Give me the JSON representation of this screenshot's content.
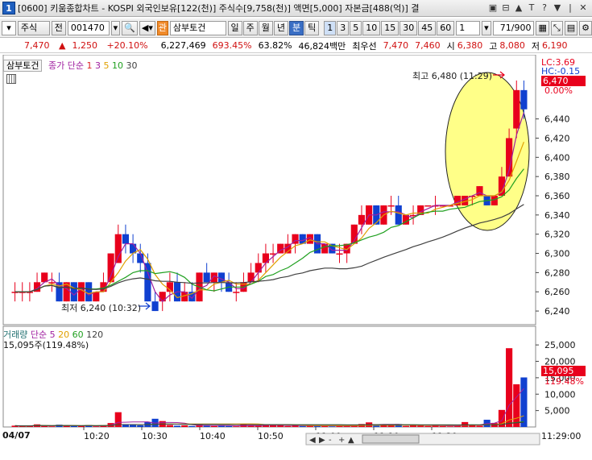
{
  "window": {
    "number": "1",
    "title": "[0600] 키움종합차트 - KOSPI 외국인보유[122(천)] 주식수[9,758(천)] 액면[5,000] 자본금[488(억)] 결",
    "buttons": [
      "▣",
      "⊟",
      "▲",
      "T",
      "?",
      "▼",
      "|",
      "✕"
    ]
  },
  "toolbar": {
    "market": "주식",
    "prev": "전",
    "code": "001470",
    "stock_badge": "관",
    "stock_name": "삼부토건",
    "periods": [
      "일",
      "주",
      "월",
      "년",
      "분",
      "틱"
    ],
    "selected_period": "분",
    "intervals": [
      "1",
      "3",
      "5",
      "10",
      "15",
      "30",
      "45",
      "60"
    ],
    "selected_interval": "1",
    "unit": "1",
    "count": "71",
    "count_total": "/900"
  },
  "quote": {
    "price": "7,470",
    "change": "1,250",
    "rate": "+20.10%",
    "volume": "6,227,469",
    "turnover": "693.45%",
    "ratio": "63.82%",
    "amount": "46,824백만",
    "pref_label": "최우선",
    "ask": "7,470",
    "bid": "7,460",
    "open_label": "시",
    "open": "6,380",
    "high_label": "고",
    "high": "8,080",
    "low_label": "저",
    "low": "6,190"
  },
  "price_panel": {
    "name": "삼부토건",
    "ma_label": "종가 단순",
    "ma_periods": [
      "1",
      "3",
      "5",
      "10",
      "30"
    ],
    "ma_colors": [
      "#d22",
      "#a020a0",
      "#e0a000",
      "#20a020",
      "#404040"
    ],
    "lc_label": "LC:3.69",
    "hc_label": "HC:-0.15",
    "current_price_box": "6,470",
    "pct_label": "0.00%",
    "high_annotation": "최고 6,480 (11:29)",
    "low_annotation": "최저 6,240 (10:32)",
    "y_ticks": [
      "6,440",
      "6,420",
      "6,400",
      "6,380",
      "6,360",
      "6,340",
      "6,320",
      "6,300",
      "6,280",
      "6,260",
      "6,240"
    ]
  },
  "volume_panel": {
    "title": "거래량",
    "ma_label": "단순",
    "ma_periods": [
      "5",
      "20",
      "60",
      "120"
    ],
    "ma_colors": [
      "#a020a0",
      "#e0a000",
      "#20a020",
      "#404040"
    ],
    "current": "15,095주(119.48%)",
    "current_box": "15,095",
    "pct_box": "119.48%",
    "y_ticks": [
      "25,000",
      "20,000",
      "15,000",
      "10,000",
      "5,000"
    ]
  },
  "x_axis": {
    "date": "04/07",
    "ticks": [
      "10:20",
      "10:30",
      "10:40",
      "10:50",
      "11:00",
      "11:10",
      "11:20"
    ],
    "end_label": "11:29:00",
    "controls": [
      "◀",
      "▶",
      "-",
      "+",
      "▲"
    ]
  },
  "colors": {
    "up": "#e8001c",
    "down": "#1040d0",
    "highlight": "#ffff88"
  },
  "chart_data": {
    "type": "candlestick",
    "x_range": [
      "10:09",
      "11:29"
    ],
    "ylim": [
      6230,
      6490
    ],
    "candles": [
      {
        "o": 6260,
        "h": 6270,
        "l": 6250,
        "c": 6260
      },
      {
        "o": 6260,
        "h": 6270,
        "l": 6250,
        "c": 6260
      },
      {
        "o": 6260,
        "h": 6270,
        "l": 6250,
        "c": 6260
      },
      {
        "o": 6260,
        "h": 6280,
        "l": 6260,
        "c": 6270
      },
      {
        "o": 6270,
        "h": 6280,
        "l": 6270,
        "c": 6280
      },
      {
        "o": 6270,
        "h": 6280,
        "l": 6260,
        "c": 6270
      },
      {
        "o": 6270,
        "h": 6280,
        "l": 6250,
        "c": 6250
      },
      {
        "o": 6250,
        "h": 6270,
        "l": 6250,
        "c": 6270
      },
      {
        "o": 6270,
        "h": 6270,
        "l": 6250,
        "c": 6250
      },
      {
        "o": 6250,
        "h": 6270,
        "l": 6250,
        "c": 6270
      },
      {
        "o": 6270,
        "h": 6270,
        "l": 6250,
        "c": 6250
      },
      {
        "o": 6250,
        "h": 6260,
        "l": 6250,
        "c": 6260
      },
      {
        "o": 6260,
        "h": 6280,
        "l": 6260,
        "c": 6270
      },
      {
        "o": 6270,
        "h": 6300,
        "l": 6270,
        "c": 6300
      },
      {
        "o": 6290,
        "h": 6330,
        "l": 6290,
        "c": 6320
      },
      {
        "o": 6320,
        "h": 6330,
        "l": 6300,
        "c": 6310
      },
      {
        "o": 6310,
        "h": 6320,
        "l": 6290,
        "c": 6300
      },
      {
        "o": 6300,
        "h": 6310,
        "l": 6280,
        "c": 6290
      },
      {
        "o": 6290,
        "h": 6300,
        "l": 6250,
        "c": 6250
      },
      {
        "o": 6250,
        "h": 6260,
        "l": 6240,
        "c": 6240
      },
      {
        "o": 6250,
        "h": 6260,
        "l": 6240,
        "c": 6260
      },
      {
        "o": 6260,
        "h": 6280,
        "l": 6250,
        "c": 6270
      },
      {
        "o": 6270,
        "h": 6280,
        "l": 6250,
        "c": 6250
      },
      {
        "o": 6250,
        "h": 6270,
        "l": 6250,
        "c": 6260
      },
      {
        "o": 6260,
        "h": 6270,
        "l": 6250,
        "c": 6250
      },
      {
        "o": 6250,
        "h": 6280,
        "l": 6250,
        "c": 6280
      },
      {
        "o": 6280,
        "h": 6290,
        "l": 6270,
        "c": 6270
      },
      {
        "o": 6270,
        "h": 6280,
        "l": 6260,
        "c": 6280
      },
      {
        "o": 6280,
        "h": 6280,
        "l": 6260,
        "c": 6270
      },
      {
        "o": 6270,
        "h": 6280,
        "l": 6260,
        "c": 6260
      },
      {
        "o": 6260,
        "h": 6270,
        "l": 6250,
        "c": 6260
      },
      {
        "o": 6260,
        "h": 6280,
        "l": 6260,
        "c": 6270
      },
      {
        "o": 6270,
        "h": 6290,
        "l": 6270,
        "c": 6280
      },
      {
        "o": 6280,
        "h": 6300,
        "l": 6270,
        "c": 6290
      },
      {
        "o": 6290,
        "h": 6310,
        "l": 6280,
        "c": 6300
      },
      {
        "o": 6300,
        "h": 6310,
        "l": 6290,
        "c": 6300
      },
      {
        "o": 6300,
        "h": 6310,
        "l": 6300,
        "c": 6310
      },
      {
        "o": 6300,
        "h": 6320,
        "l": 6300,
        "c": 6310
      },
      {
        "o": 6310,
        "h": 6320,
        "l": 6300,
        "c": 6320
      },
      {
        "o": 6320,
        "h": 6320,
        "l": 6310,
        "c": 6310
      },
      {
        "o": 6310,
        "h": 6320,
        "l": 6310,
        "c": 6320
      },
      {
        "o": 6320,
        "h": 6320,
        "l": 6300,
        "c": 6300
      },
      {
        "o": 6300,
        "h": 6310,
        "l": 6300,
        "c": 6310
      },
      {
        "o": 6310,
        "h": 6310,
        "l": 6300,
        "c": 6300
      },
      {
        "o": 6300,
        "h": 6310,
        "l": 6290,
        "c": 6300
      },
      {
        "o": 6300,
        "h": 6310,
        "l": 6290,
        "c": 6310
      },
      {
        "o": 6310,
        "h": 6330,
        "l": 6310,
        "c": 6330
      },
      {
        "o": 6330,
        "h": 6350,
        "l": 6320,
        "c": 6340
      },
      {
        "o": 6330,
        "h": 6350,
        "l": 6330,
        "c": 6350
      },
      {
        "o": 6350,
        "h": 6350,
        "l": 6330,
        "c": 6330
      },
      {
        "o": 6330,
        "h": 6350,
        "l": 6330,
        "c": 6350
      },
      {
        "o": 6350,
        "h": 6360,
        "l": 6340,
        "c": 6350
      },
      {
        "o": 6350,
        "h": 6360,
        "l": 6330,
        "c": 6330
      },
      {
        "o": 6330,
        "h": 6340,
        "l": 6330,
        "c": 6340
      },
      {
        "o": 6340,
        "h": 6350,
        "l": 6330,
        "c": 6340
      },
      {
        "o": 6340,
        "h": 6350,
        "l": 6340,
        "c": 6350
      },
      {
        "o": 6350,
        "h": 6350,
        "l": 6350,
        "c": 6350
      },
      {
        "o": 6350,
        "h": 6360,
        "l": 6340,
        "c": 6350
      },
      {
        "o": 6350,
        "h": 6350,
        "l": 6350,
        "c": 6350
      },
      {
        "o": 6350,
        "h": 6350,
        "l": 6350,
        "c": 6350
      },
      {
        "o": 6350,
        "h": 6360,
        "l": 6350,
        "c": 6360
      },
      {
        "o": 6350,
        "h": 6360,
        "l": 6350,
        "c": 6360
      },
      {
        "o": 6360,
        "h": 6360,
        "l": 6350,
        "c": 6360
      },
      {
        "o": 6360,
        "h": 6370,
        "l": 6360,
        "c": 6370
      },
      {
        "o": 6360,
        "h": 6360,
        "l": 6350,
        "c": 6350
      },
      {
        "o": 6350,
        "h": 6360,
        "l": 6350,
        "c": 6360
      },
      {
        "o": 6360,
        "h": 6390,
        "l": 6360,
        "c": 6380
      },
      {
        "o": 6380,
        "h": 6430,
        "l": 6380,
        "c": 6420
      },
      {
        "o": 6430,
        "h": 6480,
        "l": 6420,
        "c": 6470
      },
      {
        "o": 6470,
        "h": 6480,
        "l": 6440,
        "c": 6450
      }
    ],
    "volume": [
      400,
      300,
      350,
      800,
      300,
      200,
      700,
      400,
      250,
      300,
      600,
      200,
      500,
      1200,
      4500,
      800,
      600,
      500,
      1500,
      2500,
      1800,
      600,
      400,
      500,
      300,
      700,
      400,
      300,
      500,
      300,
      200,
      800,
      500,
      400,
      700,
      600,
      500,
      300,
      400,
      300,
      500,
      400,
      300,
      200,
      500,
      300,
      600,
      900,
      1400,
      400,
      700,
      500,
      900,
      300,
      600,
      400,
      300,
      500,
      300,
      200,
      400,
      1500,
      600,
      400,
      2200,
      1200,
      5200,
      24000,
      13000,
      15095
    ]
  }
}
